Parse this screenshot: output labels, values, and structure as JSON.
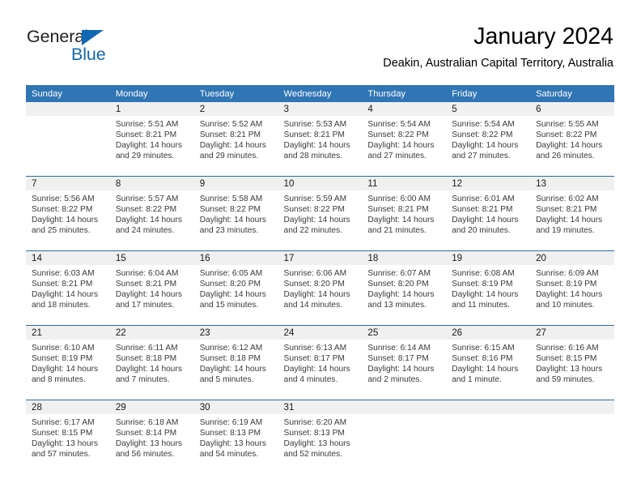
{
  "brand": {
    "name_part1": "General",
    "name_part2": "Blue",
    "triangle_icon": "triangle-icon",
    "colors": {
      "dark": "#231f20",
      "blue": "#1268b3"
    }
  },
  "header": {
    "title": "January 2024",
    "subtitle": "Deakin, Australian Capital Territory, Australia"
  },
  "theme": {
    "header_blue": "#3075b4",
    "rule_blue": "#2e6da4",
    "daynum_band": "#f0f0f0",
    "text": "#3a3a3a"
  },
  "columns": [
    "Sunday",
    "Monday",
    "Tuesday",
    "Wednesday",
    "Thursday",
    "Friday",
    "Saturday"
  ],
  "weeks": [
    [
      {
        "day": "",
        "empty": true,
        "sunrise": "",
        "sunset": "",
        "daylight1": "",
        "daylight2": ""
      },
      {
        "day": "1",
        "sunrise": "Sunrise: 5:51 AM",
        "sunset": "Sunset: 8:21 PM",
        "daylight1": "Daylight: 14 hours",
        "daylight2": "and 29 minutes."
      },
      {
        "day": "2",
        "sunrise": "Sunrise: 5:52 AM",
        "sunset": "Sunset: 8:21 PM",
        "daylight1": "Daylight: 14 hours",
        "daylight2": "and 29 minutes."
      },
      {
        "day": "3",
        "sunrise": "Sunrise: 5:53 AM",
        "sunset": "Sunset: 8:21 PM",
        "daylight1": "Daylight: 14 hours",
        "daylight2": "and 28 minutes."
      },
      {
        "day": "4",
        "sunrise": "Sunrise: 5:54 AM",
        "sunset": "Sunset: 8:22 PM",
        "daylight1": "Daylight: 14 hours",
        "daylight2": "and 27 minutes."
      },
      {
        "day": "5",
        "sunrise": "Sunrise: 5:54 AM",
        "sunset": "Sunset: 8:22 PM",
        "daylight1": "Daylight: 14 hours",
        "daylight2": "and 27 minutes."
      },
      {
        "day": "6",
        "sunrise": "Sunrise: 5:55 AM",
        "sunset": "Sunset: 8:22 PM",
        "daylight1": "Daylight: 14 hours",
        "daylight2": "and 26 minutes."
      }
    ],
    [
      {
        "day": "7",
        "sunrise": "Sunrise: 5:56 AM",
        "sunset": "Sunset: 8:22 PM",
        "daylight1": "Daylight: 14 hours",
        "daylight2": "and 25 minutes."
      },
      {
        "day": "8",
        "sunrise": "Sunrise: 5:57 AM",
        "sunset": "Sunset: 8:22 PM",
        "daylight1": "Daylight: 14 hours",
        "daylight2": "and 24 minutes."
      },
      {
        "day": "9",
        "sunrise": "Sunrise: 5:58 AM",
        "sunset": "Sunset: 8:22 PM",
        "daylight1": "Daylight: 14 hours",
        "daylight2": "and 23 minutes."
      },
      {
        "day": "10",
        "sunrise": "Sunrise: 5:59 AM",
        "sunset": "Sunset: 8:22 PM",
        "daylight1": "Daylight: 14 hours",
        "daylight2": "and 22 minutes."
      },
      {
        "day": "11",
        "sunrise": "Sunrise: 6:00 AM",
        "sunset": "Sunset: 8:21 PM",
        "daylight1": "Daylight: 14 hours",
        "daylight2": "and 21 minutes."
      },
      {
        "day": "12",
        "sunrise": "Sunrise: 6:01 AM",
        "sunset": "Sunset: 8:21 PM",
        "daylight1": "Daylight: 14 hours",
        "daylight2": "and 20 minutes."
      },
      {
        "day": "13",
        "sunrise": "Sunrise: 6:02 AM",
        "sunset": "Sunset: 8:21 PM",
        "daylight1": "Daylight: 14 hours",
        "daylight2": "and 19 minutes."
      }
    ],
    [
      {
        "day": "14",
        "sunrise": "Sunrise: 6:03 AM",
        "sunset": "Sunset: 8:21 PM",
        "daylight1": "Daylight: 14 hours",
        "daylight2": "and 18 minutes."
      },
      {
        "day": "15",
        "sunrise": "Sunrise: 6:04 AM",
        "sunset": "Sunset: 8:21 PM",
        "daylight1": "Daylight: 14 hours",
        "daylight2": "and 17 minutes."
      },
      {
        "day": "16",
        "sunrise": "Sunrise: 6:05 AM",
        "sunset": "Sunset: 8:20 PM",
        "daylight1": "Daylight: 14 hours",
        "daylight2": "and 15 minutes."
      },
      {
        "day": "17",
        "sunrise": "Sunrise: 6:06 AM",
        "sunset": "Sunset: 8:20 PM",
        "daylight1": "Daylight: 14 hours",
        "daylight2": "and 14 minutes."
      },
      {
        "day": "18",
        "sunrise": "Sunrise: 6:07 AM",
        "sunset": "Sunset: 8:20 PM",
        "daylight1": "Daylight: 14 hours",
        "daylight2": "and 13 minutes."
      },
      {
        "day": "19",
        "sunrise": "Sunrise: 6:08 AM",
        "sunset": "Sunset: 8:19 PM",
        "daylight1": "Daylight: 14 hours",
        "daylight2": "and 11 minutes."
      },
      {
        "day": "20",
        "sunrise": "Sunrise: 6:09 AM",
        "sunset": "Sunset: 8:19 PM",
        "daylight1": "Daylight: 14 hours",
        "daylight2": "and 10 minutes."
      }
    ],
    [
      {
        "day": "21",
        "sunrise": "Sunrise: 6:10 AM",
        "sunset": "Sunset: 8:19 PM",
        "daylight1": "Daylight: 14 hours",
        "daylight2": "and 8 minutes."
      },
      {
        "day": "22",
        "sunrise": "Sunrise: 6:11 AM",
        "sunset": "Sunset: 8:18 PM",
        "daylight1": "Daylight: 14 hours",
        "daylight2": "and 7 minutes."
      },
      {
        "day": "23",
        "sunrise": "Sunrise: 6:12 AM",
        "sunset": "Sunset: 8:18 PM",
        "daylight1": "Daylight: 14 hours",
        "daylight2": "and 5 minutes."
      },
      {
        "day": "24",
        "sunrise": "Sunrise: 6:13 AM",
        "sunset": "Sunset: 8:17 PM",
        "daylight1": "Daylight: 14 hours",
        "daylight2": "and 4 minutes."
      },
      {
        "day": "25",
        "sunrise": "Sunrise: 6:14 AM",
        "sunset": "Sunset: 8:17 PM",
        "daylight1": "Daylight: 14 hours",
        "daylight2": "and 2 minutes."
      },
      {
        "day": "26",
        "sunrise": "Sunrise: 6:15 AM",
        "sunset": "Sunset: 8:16 PM",
        "daylight1": "Daylight: 14 hours",
        "daylight2": "and 1 minute."
      },
      {
        "day": "27",
        "sunrise": "Sunrise: 6:16 AM",
        "sunset": "Sunset: 8:15 PM",
        "daylight1": "Daylight: 13 hours",
        "daylight2": "and 59 minutes."
      }
    ],
    [
      {
        "day": "28",
        "sunrise": "Sunrise: 6:17 AM",
        "sunset": "Sunset: 8:15 PM",
        "daylight1": "Daylight: 13 hours",
        "daylight2": "and 57 minutes."
      },
      {
        "day": "29",
        "sunrise": "Sunrise: 6:18 AM",
        "sunset": "Sunset: 8:14 PM",
        "daylight1": "Daylight: 13 hours",
        "daylight2": "and 56 minutes."
      },
      {
        "day": "30",
        "sunrise": "Sunrise: 6:19 AM",
        "sunset": "Sunset: 8:13 PM",
        "daylight1": "Daylight: 13 hours",
        "daylight2": "and 54 minutes."
      },
      {
        "day": "31",
        "sunrise": "Sunrise: 6:20 AM",
        "sunset": "Sunset: 8:13 PM",
        "daylight1": "Daylight: 13 hours",
        "daylight2": "and 52 minutes."
      },
      {
        "day": "",
        "empty": true,
        "sunrise": "",
        "sunset": "",
        "daylight1": "",
        "daylight2": ""
      },
      {
        "day": "",
        "empty": true,
        "sunrise": "",
        "sunset": "",
        "daylight1": "",
        "daylight2": ""
      },
      {
        "day": "",
        "empty": true,
        "sunrise": "",
        "sunset": "",
        "daylight1": "",
        "daylight2": ""
      }
    ]
  ]
}
